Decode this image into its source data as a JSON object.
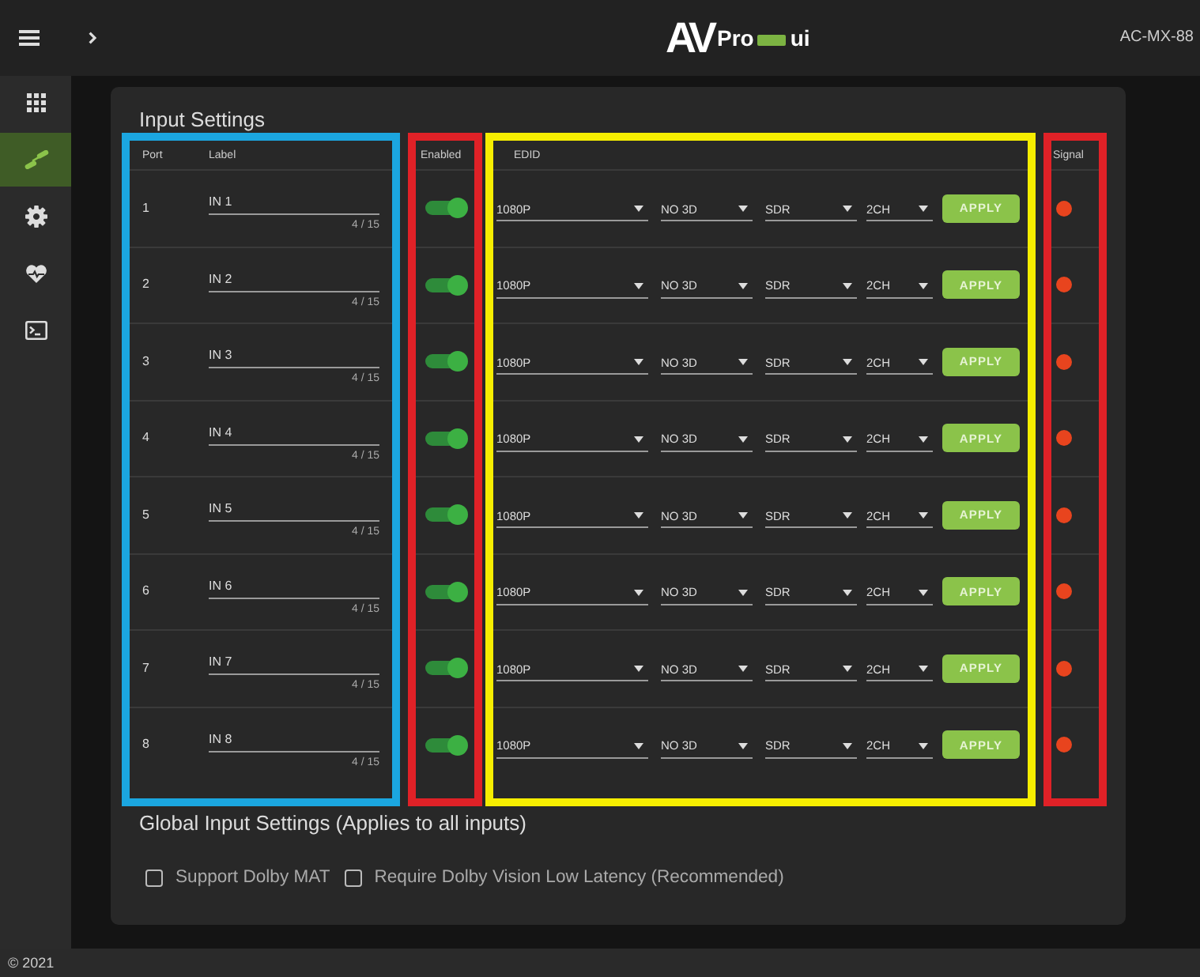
{
  "top_bar": {
    "logo": {
      "mark": "AV",
      "name": "Pro",
      "suffix": "ui"
    },
    "device": "AC-MX-88"
  },
  "sidebar": {
    "items": [
      {
        "kind": "grid",
        "selected": false
      },
      {
        "kind": "link",
        "selected": true
      },
      {
        "kind": "gear",
        "selected": false
      },
      {
        "kind": "heart",
        "selected": false
      },
      {
        "kind": "terminal",
        "selected": false
      }
    ]
  },
  "input_settings": {
    "title": "Input Settings",
    "groups": [
      {
        "kind": "label",
        "color": "#1ba6e0",
        "columns": [
          "Port",
          "Label"
        ]
      },
      {
        "kind": "toggle",
        "color": "#e02127",
        "columns": [
          "Enabled"
        ]
      },
      {
        "kind": "edid",
        "color": "#f6ee00",
        "columns": [
          "EDID"
        ]
      },
      {
        "kind": "signal",
        "color": "#e02127",
        "columns": [
          "Signal"
        ]
      }
    ],
    "rows": [
      {
        "port": "1",
        "label": "IN 1",
        "counter": "4 / 15",
        "enabled": true,
        "edid": [
          "1080P",
          "NO 3D",
          "SDR",
          "2CH"
        ],
        "apply": "APPLY",
        "signal": false
      },
      {
        "port": "2",
        "label": "IN 2",
        "counter": "4 / 15",
        "enabled": true,
        "edid": [
          "1080P",
          "NO 3D",
          "SDR",
          "2CH"
        ],
        "apply": "APPLY",
        "signal": false
      },
      {
        "port": "3",
        "label": "IN 3",
        "counter": "4 / 15",
        "enabled": true,
        "edid": [
          "1080P",
          "NO 3D",
          "SDR",
          "2CH"
        ],
        "apply": "APPLY",
        "signal": false
      },
      {
        "port": "4",
        "label": "IN 4",
        "counter": "4 / 15",
        "enabled": true,
        "edid": [
          "1080P",
          "NO 3D",
          "SDR",
          "2CH"
        ],
        "apply": "APPLY",
        "signal": false
      },
      {
        "port": "5",
        "label": "IN 5",
        "counter": "4 / 15",
        "enabled": true,
        "edid": [
          "1080P",
          "NO 3D",
          "SDR",
          "2CH"
        ],
        "apply": "APPLY",
        "signal": false
      },
      {
        "port": "6",
        "label": "IN 6",
        "counter": "4 / 15",
        "enabled": true,
        "edid": [
          "1080P",
          "NO 3D",
          "SDR",
          "2CH"
        ],
        "apply": "APPLY",
        "signal": false
      },
      {
        "port": "7",
        "label": "IN 7",
        "counter": "4 / 15",
        "enabled": true,
        "edid": [
          "1080P",
          "NO 3D",
          "SDR",
          "2CH"
        ],
        "apply": "APPLY",
        "signal": false
      },
      {
        "port": "8",
        "label": "IN 8",
        "counter": "4 / 15",
        "enabled": true,
        "edid": [
          "1080P",
          "NO 3D",
          "SDR",
          "2CH"
        ],
        "apply": "APPLY",
        "signal": false
      }
    ]
  },
  "global_settings": {
    "title": "Global Input Settings (Applies to all inputs)",
    "options": [
      {
        "label": "Support Dolby MAT",
        "checked": false
      },
      {
        "label": "Require Dolby Vision Low Latency (Recommended)",
        "checked": false
      }
    ]
  },
  "footer": "© 2021"
}
